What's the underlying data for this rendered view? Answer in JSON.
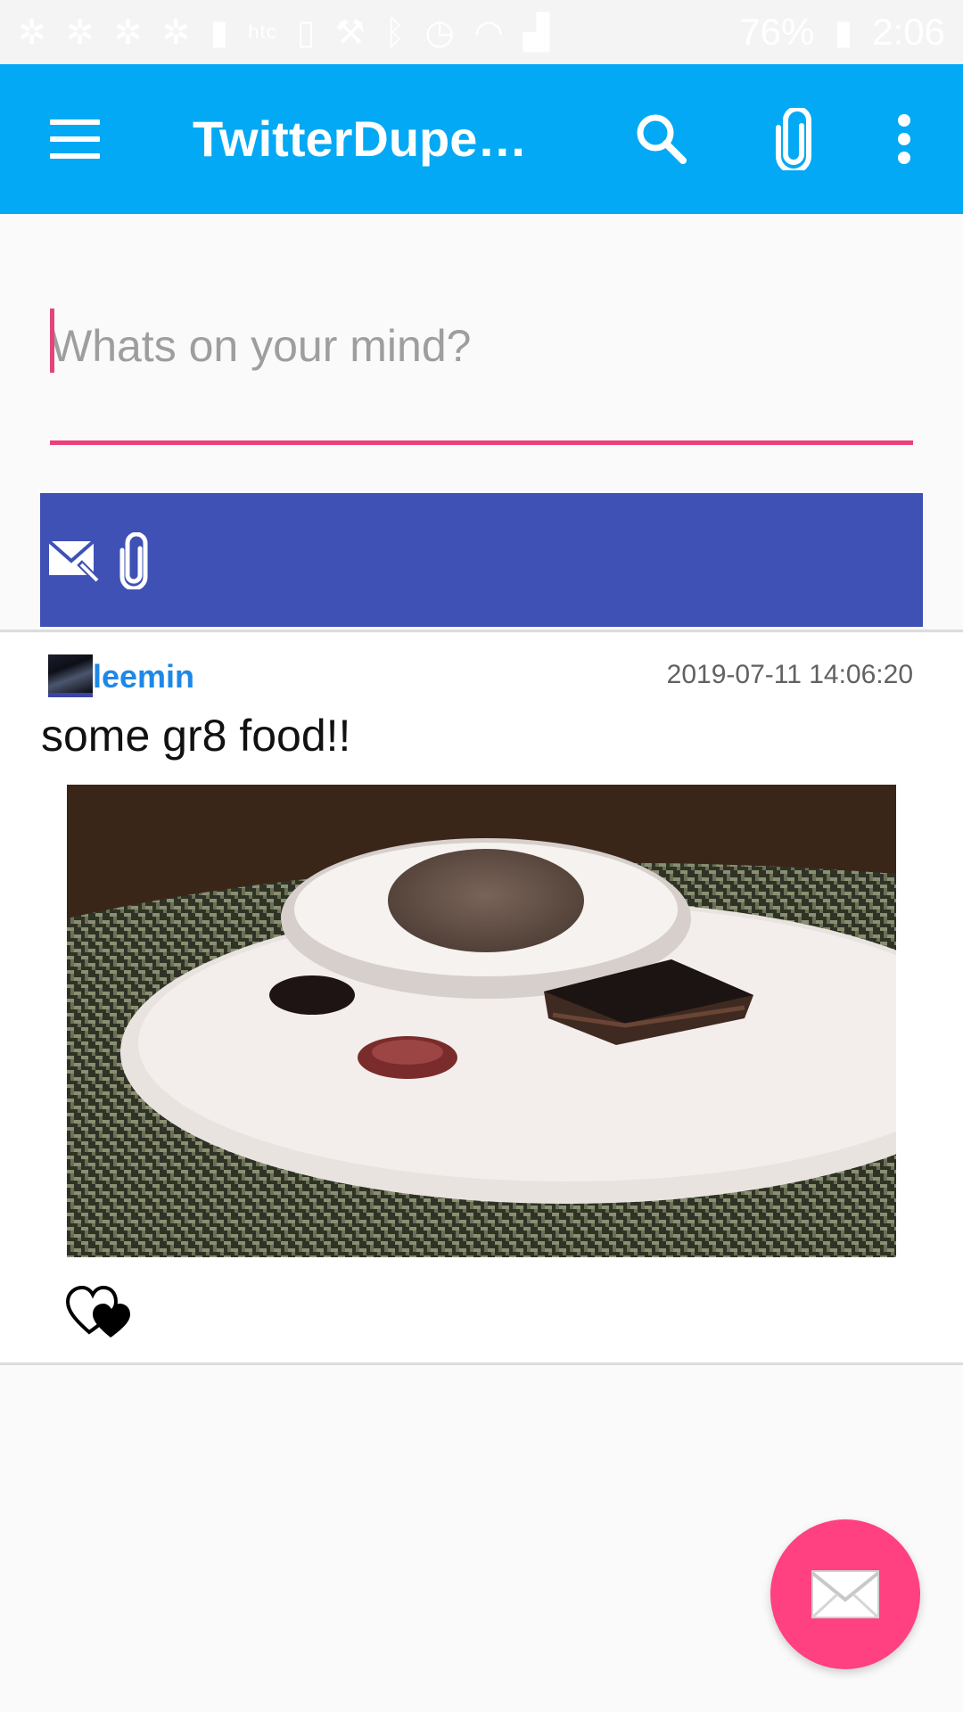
{
  "status_bar": {
    "carrier": "htc",
    "battery": "76%",
    "time": "2:06"
  },
  "app_bar": {
    "title": "TwitterDupeW…",
    "icons": [
      "menu-icon",
      "search-icon",
      "paperclip-icon",
      "more-vert-icon"
    ]
  },
  "compose": {
    "placeholder": "Whats on your mind?",
    "value": ""
  },
  "action_bar": {
    "icons": [
      "mail-edit-icon",
      "paperclip-icon"
    ]
  },
  "post": {
    "username": "leemin",
    "timestamp": "2019-07-11 14:06:20",
    "text": "some gr8 food!!",
    "image_alt": "Dessert plate with chocolate ice cream and cake"
  },
  "fab": {
    "icon": "mail-icon"
  },
  "colors": {
    "app_bar": "#03a9f4",
    "action_bar": "#3f51b5",
    "accent": "#ff4081",
    "username": "#1e88e5"
  }
}
